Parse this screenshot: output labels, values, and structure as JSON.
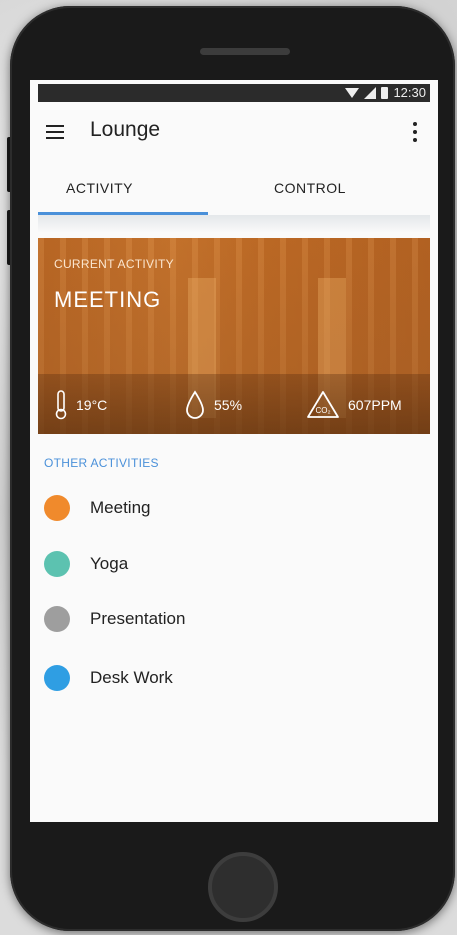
{
  "status_bar": {
    "time": "12:30"
  },
  "app_bar": {
    "title": "Lounge"
  },
  "tabs": [
    {
      "label": "ACTIVITY",
      "active": true
    },
    {
      "label": "CONTROL",
      "active": false
    }
  ],
  "current_activity": {
    "label": "CURRENT ACTIVITY",
    "name": "MEETING",
    "temperature": "19°C",
    "humidity": "55%",
    "co2": "607PPM",
    "co2_icon_text": "CO₂"
  },
  "other_activities": {
    "label": "OTHER ACTIVITIES",
    "items": [
      {
        "label": "Meeting",
        "color": "#f08a2c"
      },
      {
        "label": "Yoga",
        "color": "#5cc2b0"
      },
      {
        "label": "Presentation",
        "color": "#9e9e9e"
      },
      {
        "label": "Desk Work",
        "color": "#2f9ee3"
      }
    ]
  },
  "colors": {
    "accent": "#4a90d9",
    "hero": "#c7782e"
  }
}
